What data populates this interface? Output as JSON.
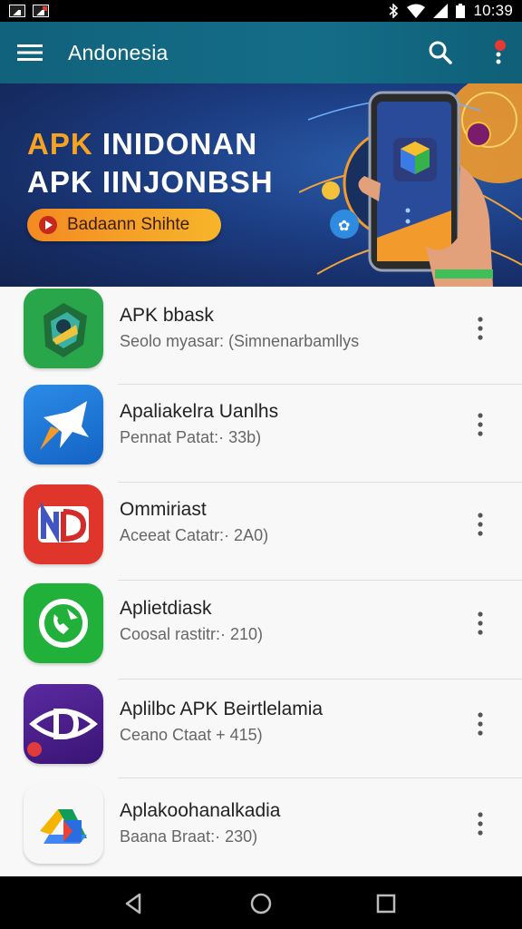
{
  "status_bar": {
    "time": "10:39",
    "icons": [
      "gallery-icon",
      "gallery-alert-icon",
      "bluetooth-icon",
      "wifi-icon",
      "signal-icon",
      "battery-icon"
    ]
  },
  "app_bar": {
    "title": "Andonesia",
    "icons": [
      "menu-icon",
      "search-icon",
      "more-vert-icon"
    ]
  },
  "banner": {
    "line1_orange": "APK",
    "line1_white": " INIDONAN",
    "line2": "APK IINJONBSH",
    "button_label": "Badaann Shihte"
  },
  "apps": [
    {
      "name": "APK bbask",
      "subtitle": "Seolo myasar: (Simnenarbamllys",
      "icon": "shield-app-icon"
    },
    {
      "name": "Apaliakelra Uanlhs",
      "subtitle": "Pennat Patat:· 33b)",
      "icon": "star-app-icon"
    },
    {
      "name": "Ommiriast",
      "subtitle": "Aceeat Catatr:· 2A0)",
      "icon": "nd-app-icon"
    },
    {
      "name": "Aplietdiask",
      "subtitle": "Coosal rastitr:· 210)",
      "icon": "phone-app-icon"
    },
    {
      "name": "Aplilbc APK Beirtlelamia",
      "subtitle": "Ceano Ctaat + 415)",
      "icon": "d-app-icon"
    },
    {
      "name": "Aplakoohanalkadia",
      "subtitle": "Baana Braat:· 230)",
      "icon": "drive-app-icon"
    }
  ],
  "colors": {
    "app_bar": "#11627c",
    "banner_orange": "#f6a323",
    "accent_red": "#e53935"
  }
}
